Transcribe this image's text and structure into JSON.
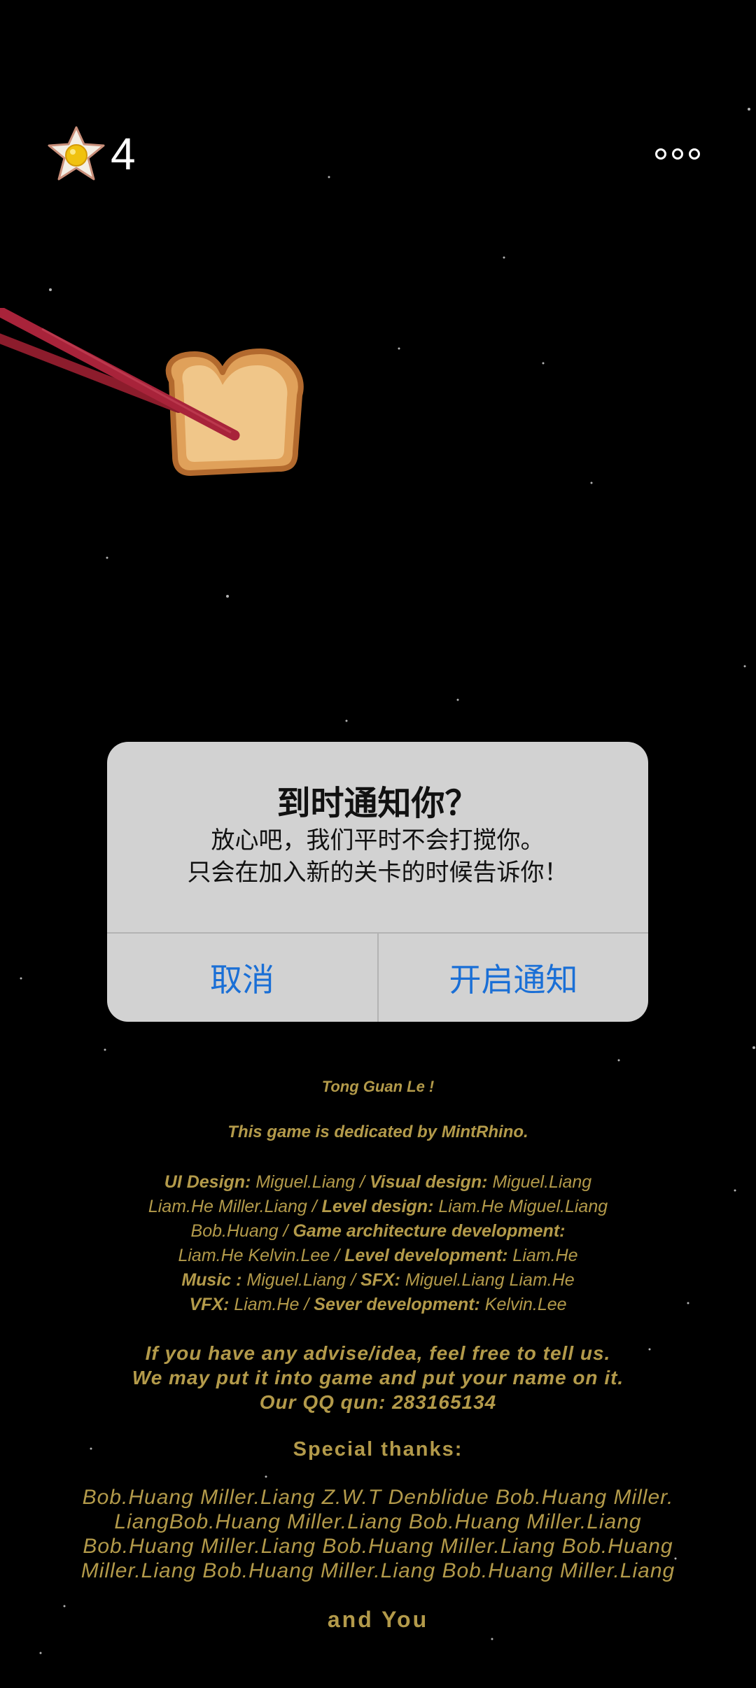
{
  "hud": {
    "score": "4",
    "egg_icon": "fried-egg-star-icon",
    "more_icon": "more-dots-icon"
  },
  "dialog": {
    "title": "到时通知你？",
    "message_line1": "放心吧，我们平时不会打搅你。",
    "message_line2": "只会在加入新的关卡的时候告诉你！",
    "cancel_label": "取消",
    "confirm_label": "开启通知"
  },
  "credits": {
    "title": "Tong Guan Le !",
    "dedication": "This game is dedicated by MintRhino.",
    "roles": [
      {
        "a_label": "UI Design:",
        "a_value": " Miguel.Liang / ",
        "b_label": "Visual design:",
        "b_value": " Miguel.Liang"
      },
      {
        "a_label": "",
        "a_value": "Liam.He Miller.Liang / ",
        "b_label": "Level design:",
        "b_value": " Liam.He Miguel.Liang"
      },
      {
        "a_label": "",
        "a_value": "Bob.Huang / ",
        "b_label": " Game architecture development:",
        "b_value": ""
      },
      {
        "a_label": "",
        "a_value": "Liam.He Kelvin.Lee / ",
        "b_label": "Level development:",
        "b_value": " Liam.He"
      },
      {
        "a_label": "Music :",
        "a_value": " Miguel.Liang / ",
        "b_label": "SFX:",
        "b_value": " Miguel.Liang Liam.He"
      },
      {
        "a_label": "VFX:",
        "a_value": " Liam.He / ",
        "b_label": "Sever development:",
        "b_value": " Kelvin.Lee"
      }
    ],
    "advise_line1": "If you have any advise/idea, feel free to tell us.",
    "advise_line2": "We may put it into game and put your name on it.",
    "advise_line3": "Our QQ qun: 283165134",
    "special_thanks": "Special thanks:",
    "names": [
      "Bob.Huang Miller.Liang Z.W.T Denblidue Bob.Huang Miller.",
      "LiangBob.Huang Miller.Liang Bob.Huang Miller.Liang",
      "Bob.Huang Miller.Liang Bob.Huang Miller.Liang Bob.Huang",
      "Miller.Liang Bob.Huang Miller.Liang Bob.Huang Miller.Liang"
    ],
    "closing": "and You"
  }
}
